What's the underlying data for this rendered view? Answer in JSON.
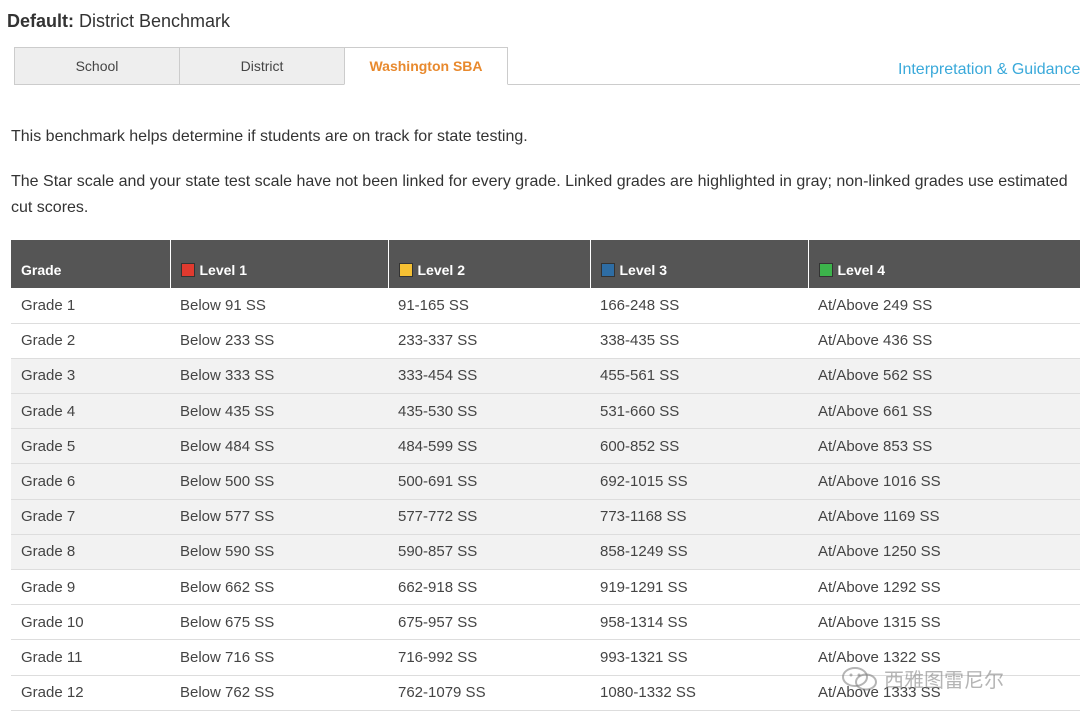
{
  "header": {
    "default_label": "Default:",
    "default_value": "District Benchmark"
  },
  "tabs": [
    {
      "label": "School"
    },
    {
      "label": "District"
    },
    {
      "label": "Washington SBA"
    }
  ],
  "guidance_link": "Interpretation & Guidance",
  "intro": {
    "line1": "This benchmark helps determine if students are on track for state testing.",
    "line2": "The Star scale and your state test scale have not been linked for every grade. Linked grades are highlighted in gray; non-linked grades use estimated cut scores."
  },
  "table": {
    "headers": [
      "Grade",
      "Level 1",
      "Level 2",
      "Level 3",
      "Level 4"
    ],
    "level_colors": [
      "#e03a2f",
      "#f5c033",
      "#2e6da4",
      "#3cb44b"
    ],
    "rows": [
      [
        "Grade 1",
        "Below 91 SS",
        "91-165 SS",
        "166-248 SS",
        "At/Above 249 SS"
      ],
      [
        "Grade 2",
        "Below 233 SS",
        "233-337 SS",
        "338-435 SS",
        "At/Above 436 SS"
      ],
      [
        "Grade 3",
        "Below 333 SS",
        "333-454 SS",
        "455-561 SS",
        "At/Above 562 SS"
      ],
      [
        "Grade 4",
        "Below 435 SS",
        "435-530 SS",
        "531-660 SS",
        "At/Above 661 SS"
      ],
      [
        "Grade 5",
        "Below 484 SS",
        "484-599 SS",
        "600-852 SS",
        "At/Above 853 SS"
      ],
      [
        "Grade 6",
        "Below 500 SS",
        "500-691 SS",
        "692-1015 SS",
        "At/Above 1016 SS"
      ],
      [
        "Grade 7",
        "Below 577 SS",
        "577-772 SS",
        "773-1168 SS",
        "At/Above 1169 SS"
      ],
      [
        "Grade 8",
        "Below 590 SS",
        "590-857 SS",
        "858-1249 SS",
        "At/Above 1250 SS"
      ],
      [
        "Grade 9",
        "Below 662 SS",
        "662-918 SS",
        "919-1291 SS",
        "At/Above 1292 SS"
      ],
      [
        "Grade 10",
        "Below 675 SS",
        "675-957 SS",
        "958-1314 SS",
        "At/Above 1315 SS"
      ],
      [
        "Grade 11",
        "Below 716 SS",
        "716-992 SS",
        "993-1321 SS",
        "At/Above 1322 SS"
      ],
      [
        "Grade 12",
        "Below 762 SS",
        "762-1079 SS",
        "1080-1332 SS",
        "At/Above 1333 SS"
      ]
    ]
  },
  "watermark": {
    "text": "西雅图雷尼尔",
    "icon": "wechat-icon"
  }
}
